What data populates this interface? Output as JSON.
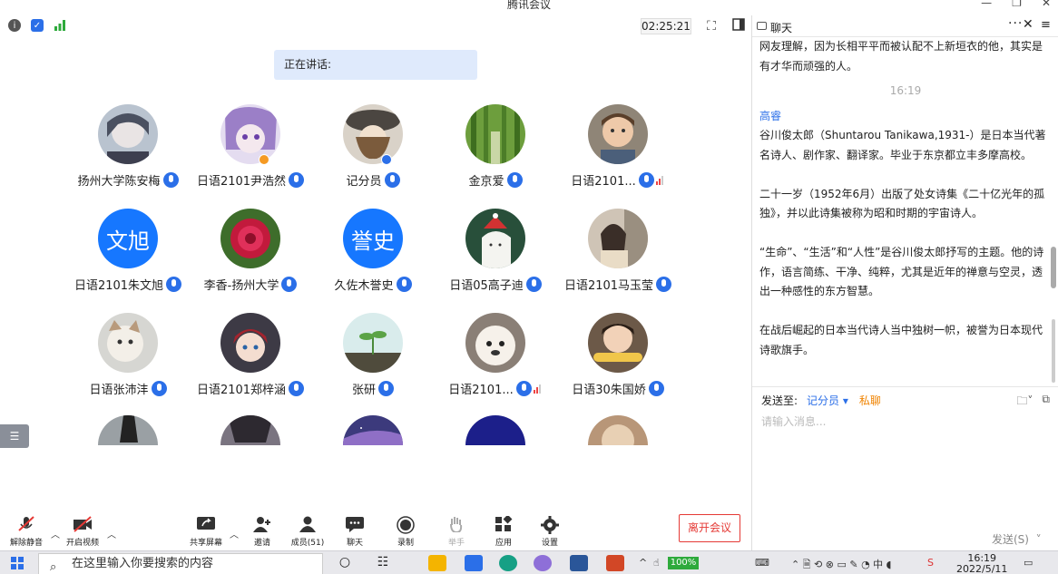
{
  "window": {
    "title": "腾讯会议"
  },
  "topbar": {
    "timer": "02:25:21"
  },
  "speaking": {
    "label": "正在讲话:"
  },
  "participants": [
    {
      "name": "扬州大学陈安梅",
      "avatar": "anime-boy",
      "signal": false
    },
    {
      "name": "日语2101尹浩然",
      "avatar": "anime-purple",
      "signal": false,
      "badge": "orange"
    },
    {
      "name": "记分员",
      "avatar": "anime-hat",
      "signal": false,
      "badge": "blue"
    },
    {
      "name": "金京爱",
      "avatar": "bamboo",
      "signal": false
    },
    {
      "name": "日语2101...",
      "avatar": "child-photo",
      "signal": true
    },
    {
      "name": "日语2101朱文旭",
      "avatar_text": "文旭",
      "signal": false
    },
    {
      "name": "李香-扬州大学",
      "avatar": "peony",
      "signal": false
    },
    {
      "name": "久佐木誉史",
      "avatar_text": "誉史",
      "signal": false
    },
    {
      "name": "日语05高子迪",
      "avatar": "cartoon-hat",
      "signal": false
    },
    {
      "name": "日语2101马玉莹",
      "avatar": "girl-photo",
      "signal": false
    },
    {
      "name": "日语张沛沣",
      "avatar": "cat",
      "signal": false
    },
    {
      "name": "日语2101郑梓涵",
      "avatar": "anime-red",
      "signal": false
    },
    {
      "name": "张研",
      "avatar": "sprout",
      "signal": false
    },
    {
      "name": "日语2101...",
      "avatar": "dog",
      "signal": true
    },
    {
      "name": "日语30朱国娇",
      "avatar": "baby",
      "signal": false
    }
  ],
  "toolbar": {
    "items": [
      {
        "label": "解除静音",
        "icon": "mic-muted-icon"
      },
      {
        "label": "开启视频",
        "icon": "video-off-icon"
      },
      {
        "label": "共享屏幕",
        "icon": "share-screen-icon"
      },
      {
        "label": "邀请",
        "icon": "invite-icon"
      },
      {
        "label": "成员(51)",
        "icon": "members-icon"
      },
      {
        "label": "聊天",
        "icon": "chat-icon"
      },
      {
        "label": "录制",
        "icon": "record-icon"
      },
      {
        "label": "举手",
        "icon": "raise-hand-icon"
      },
      {
        "label": "应用",
        "icon": "apps-icon"
      },
      {
        "label": "设置",
        "icon": "settings-icon"
      }
    ],
    "leave": "离开会议"
  },
  "chat": {
    "title": "聊天",
    "messages": {
      "m0": "网友理解，因为长相平平而被认配不上新垣衣的他，其实是有才华而顽强的人。",
      "time": "16:19",
      "sender": "高睿",
      "p1": "谷川俊太郎（Shuntarou Tanikawa,1931-）是日本当代著名诗人、剧作家、翻译家。毕业于东京都立丰多摩高校。",
      "p2": "二十一岁（1952年6月）出版了处女诗集《二十亿光年的孤独》，并以此诗集被称为昭和时期的宇宙诗人。",
      "p3": "“生命”、“生活”和“人性”是谷川俊太郎抒写的主题。他的诗作，语言简练、干净、纯粹，尤其是近年的禅意与空灵，透出一种感性的东方智慧。",
      "p4": "在战后崛起的日本当代诗人当中独树一帜，被誉为日本现代诗歌旗手。"
    },
    "send_to_label": "发送至:",
    "recipient": "记分员",
    "private": "私聊",
    "input_placeholder": "请输入消息...",
    "send": "发送(S)"
  },
  "taskbar": {
    "search_placeholder": "在这里输入你要搜索的内容",
    "battery": "100%",
    "time": "16:19",
    "date": "2022/5/11"
  }
}
